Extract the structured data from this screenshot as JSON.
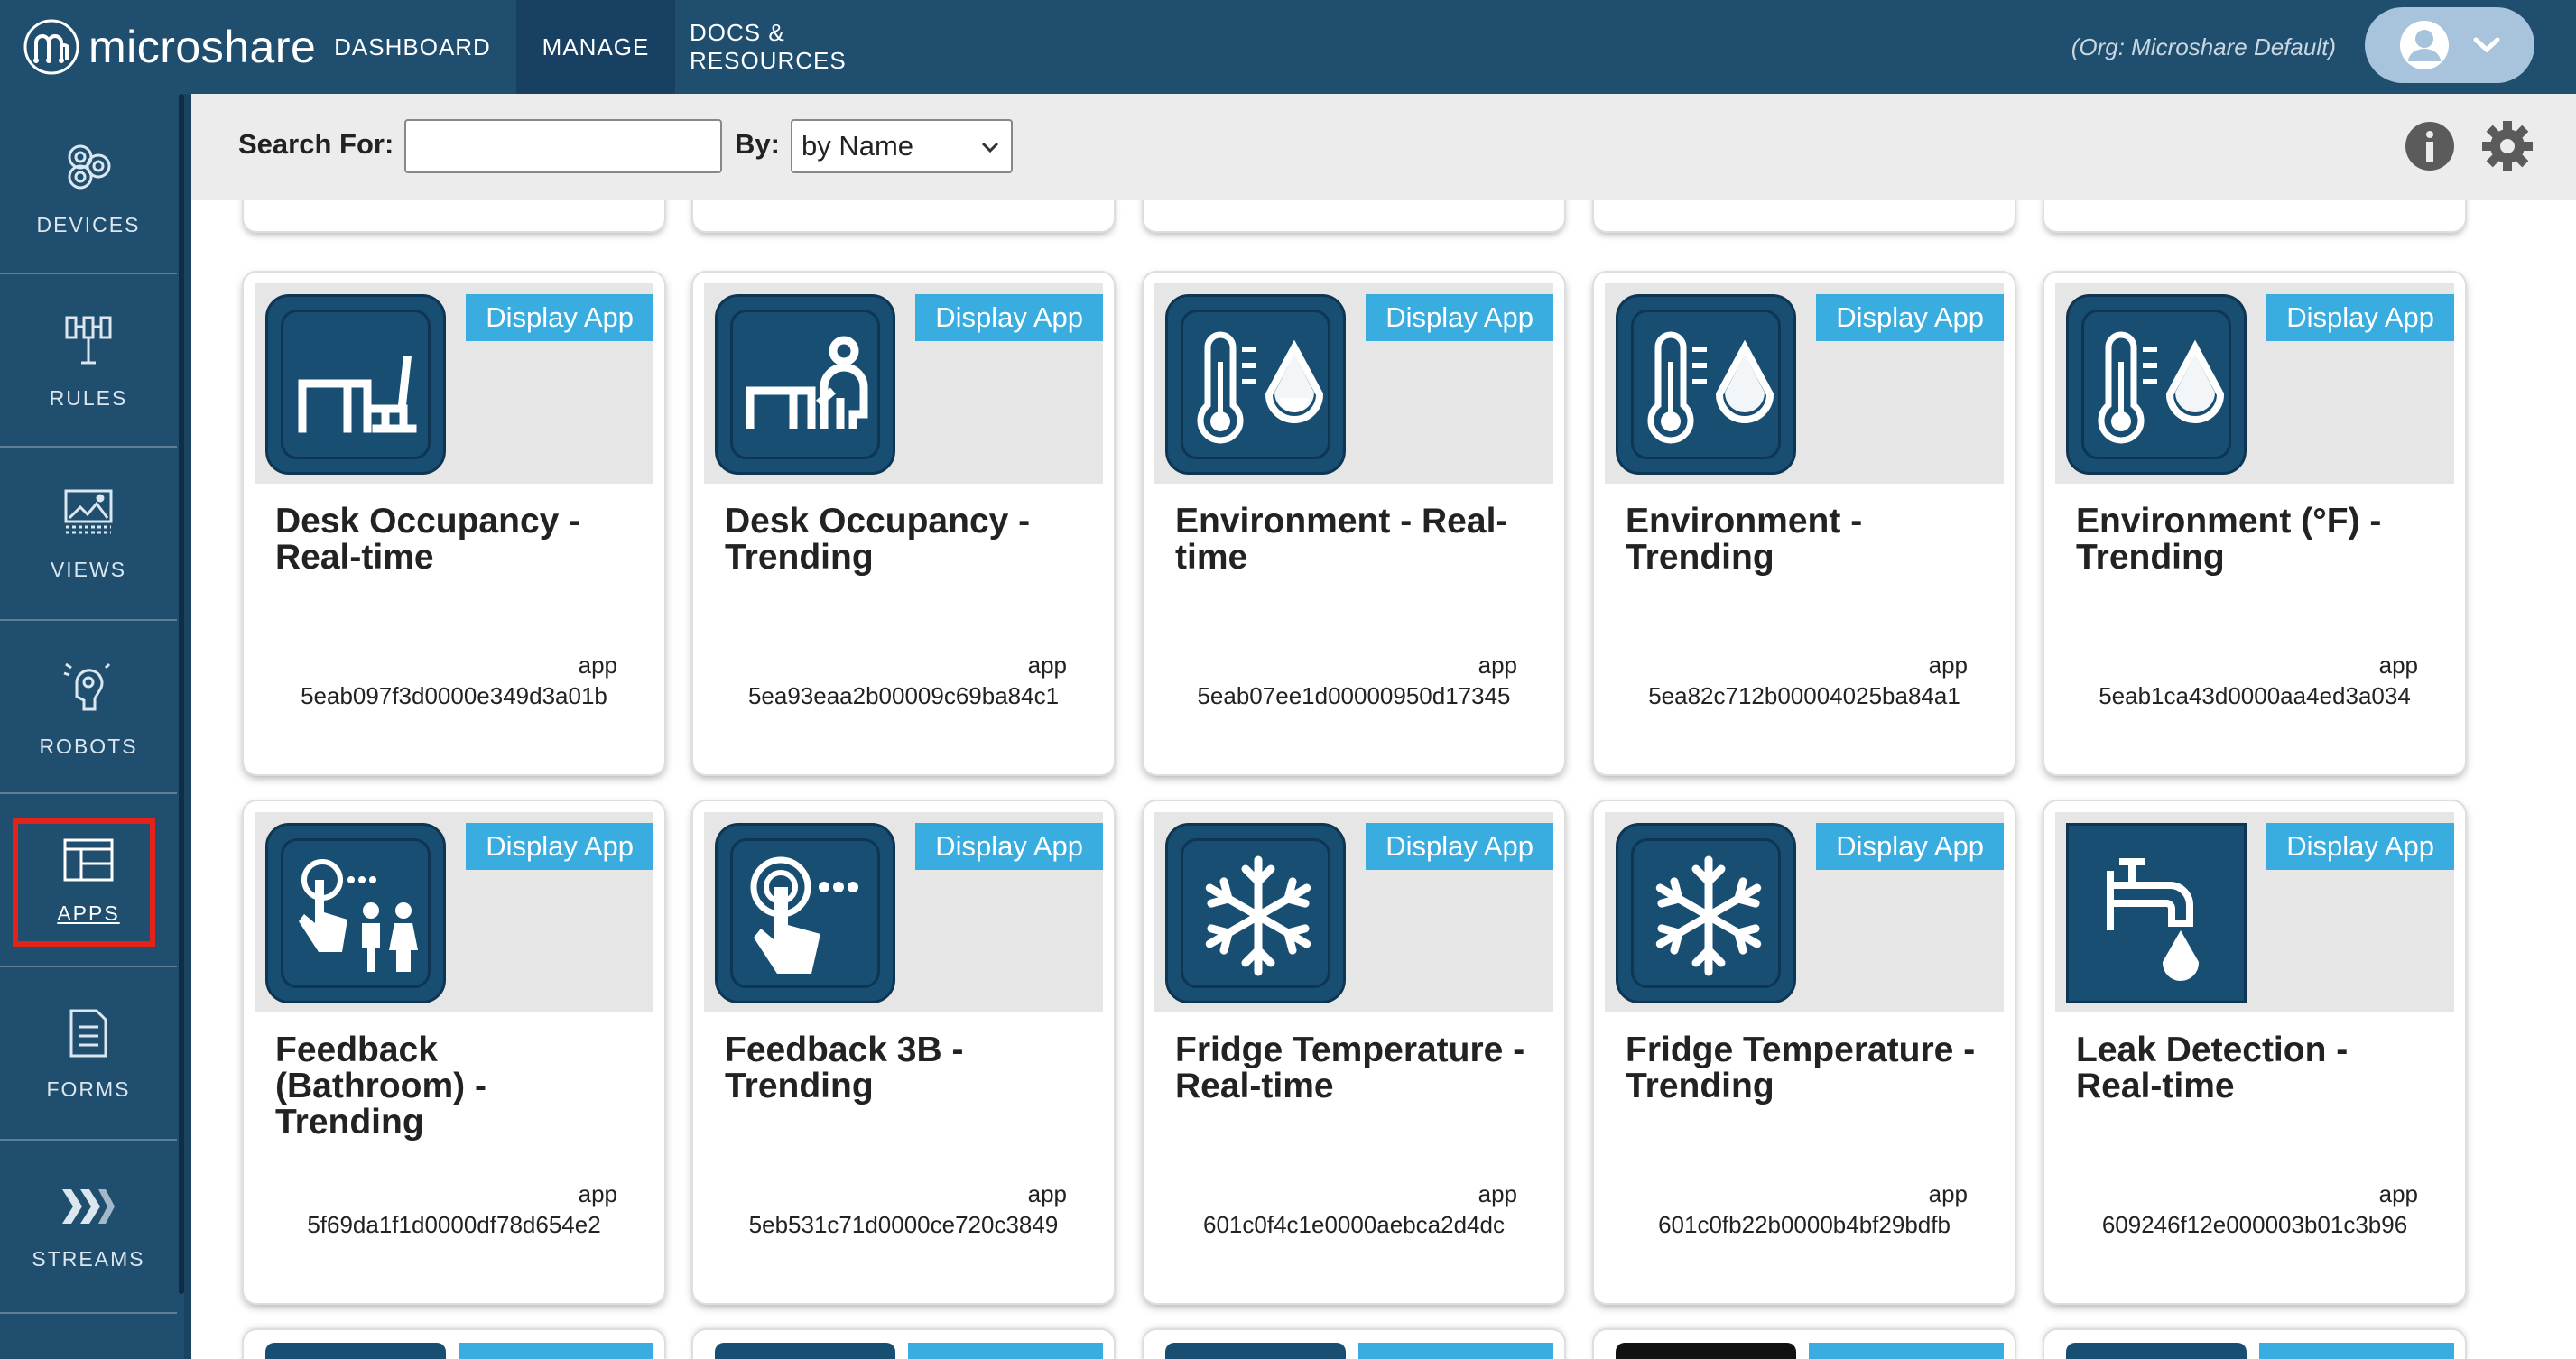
{
  "brand": {
    "name": "microshare"
  },
  "nav": {
    "items": [
      {
        "label": "DASHBOARD"
      },
      {
        "label": "MANAGE"
      },
      {
        "label": "DOCS & RESOURCES"
      }
    ],
    "org": "(Org: Microshare Default)"
  },
  "sidebar": {
    "items": [
      {
        "label": "DEVICES"
      },
      {
        "label": "RULES"
      },
      {
        "label": "VIEWS"
      },
      {
        "label": "ROBOTS"
      },
      {
        "label": "APPS"
      },
      {
        "label": "FORMS"
      },
      {
        "label": "STREAMS"
      }
    ]
  },
  "search": {
    "label": "Search For:",
    "value": "",
    "by_label": "By:",
    "by_value": "by Name"
  },
  "cards": [
    {
      "badge": "Display App",
      "title": "Desk Occupancy - Real-time",
      "type": "app",
      "id": "5eab097f3d0000e349d3a01b",
      "icon": "desk-icon"
    },
    {
      "badge": "Display App",
      "title": "Desk Occupancy - Trending",
      "type": "app",
      "id": "5ea93eaa2b00009c69ba84c1",
      "icon": "desk-person-icon"
    },
    {
      "badge": "Display App",
      "title": "Environment - Real-time",
      "type": "app",
      "id": "5eab07ee1d00000950d17345",
      "icon": "thermometer-drop-icon"
    },
    {
      "badge": "Display App",
      "title": "Environment - Trending",
      "type": "app",
      "id": "5ea82c712b00004025ba84a1",
      "icon": "thermometer-drop-icon"
    },
    {
      "badge": "Display App",
      "title": "Environment (°F) - Trending",
      "type": "app",
      "id": "5eab1ca43d0000aa4ed3a034",
      "icon": "thermometer-drop-icon"
    },
    {
      "badge": "Display App",
      "title": "Feedback (Bathroom) - Trending",
      "type": "app",
      "id": "5f69da1f1d0000df78d654e2",
      "icon": "feedback-people-icon"
    },
    {
      "badge": "Display App",
      "title": "Feedback 3B - Trending",
      "type": "app",
      "id": "5eb531c71d0000ce720c3849",
      "icon": "feedback-touch-icon"
    },
    {
      "badge": "Display App",
      "title": "Fridge Temperature - Real-time",
      "type": "app",
      "id": "601c0f4c1e0000aebca2d4dc",
      "icon": "snowflake-icon"
    },
    {
      "badge": "Display App",
      "title": "Fridge Temperature - Trending",
      "type": "app",
      "id": "601c0fb22b0000b4bf29bdfb",
      "icon": "snowflake-icon"
    },
    {
      "badge": "Display App",
      "title": "Leak Detection - Real-time",
      "type": "app",
      "id": "609246f12e000003b01c3b96",
      "icon": "faucet-drop-icon"
    }
  ],
  "colors": {
    "nav_bg": "#1f4e6e",
    "badge": "#3aade0",
    "icon_tile": "#174e72",
    "highlight": "#e2231a"
  }
}
